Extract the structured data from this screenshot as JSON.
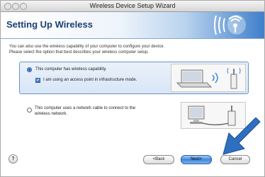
{
  "window": {
    "title": "Wireless Device Setup Wizard"
  },
  "banner": {
    "title": "Setting Up Wireless"
  },
  "instructions": [
    "You can also use the wireless capability of your computer to configure your device.",
    "Please select the option that best describes your wireless computer setup."
  ],
  "options": {
    "wireless": {
      "label": "This computer has wireless capability.",
      "selected": true,
      "sub": {
        "label": "I am using an access point in infrastructure mode.",
        "checked": true
      }
    },
    "cable": {
      "label_line1": "This computer uses a network cable to connect to the",
      "label_line2": "wireless network.",
      "selected": false
    }
  },
  "buttons": {
    "help": "?",
    "back": "<Back",
    "next": "Next>",
    "cancel": "Cancel"
  },
  "colors": {
    "accent": "#3e86dc",
    "title": "#1b3f73",
    "arrow": "#2f6fbf"
  }
}
